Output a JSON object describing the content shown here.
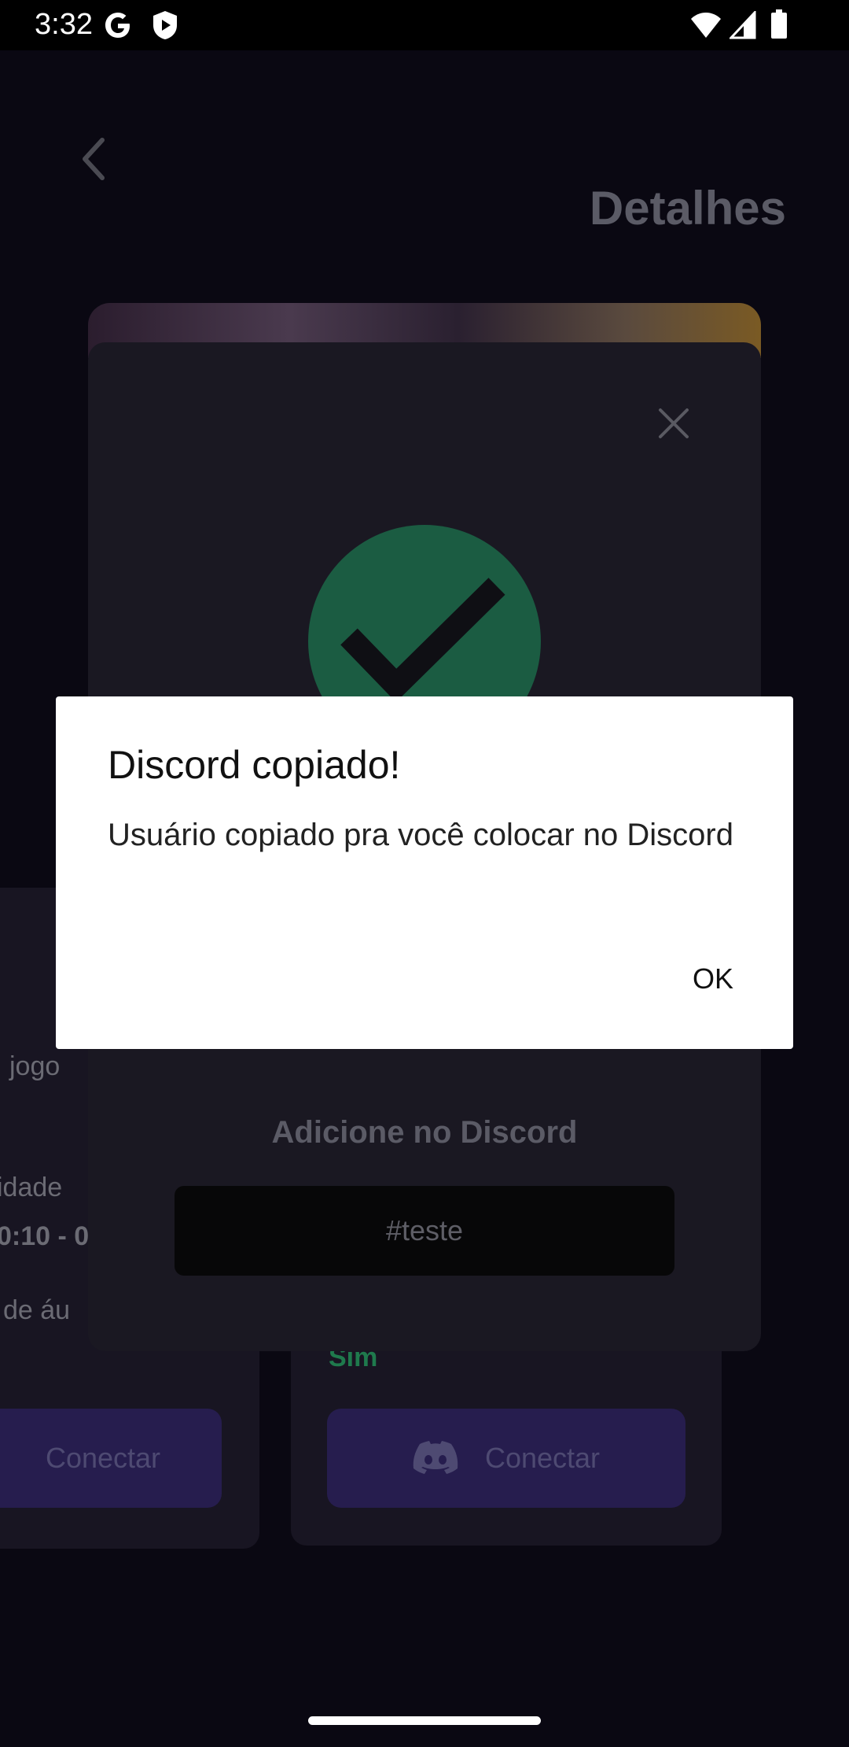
{
  "status_bar": {
    "time": "3:32",
    "icons": [
      "google-icon",
      "shield-play-icon",
      "wifi-icon",
      "signal-icon",
      "battery-icon"
    ]
  },
  "header": {
    "back_icon": "chevron-left-icon",
    "title": "Detalhes"
  },
  "background_cards": {
    "left_card_lines": [
      "jogo",
      "idade",
      "0:10 - 0",
      "de áu"
    ],
    "right_card_value": "Sim",
    "connect_left_label": "Conectar",
    "connect_right_label": "Conectar"
  },
  "success_modal": {
    "close_icon": "close-icon",
    "check_icon": "checkmark-icon",
    "discord_heading": "Adicione no Discord",
    "discord_user": "#teste"
  },
  "alert": {
    "title": "Discord copiado!",
    "message": "Usuário copiado pra você colocar no Discord",
    "ok_label": "OK"
  },
  "colors": {
    "success_green": "#1b5c42",
    "connect_purple": "#261d4e",
    "dialog_bg": "#ffffff"
  }
}
